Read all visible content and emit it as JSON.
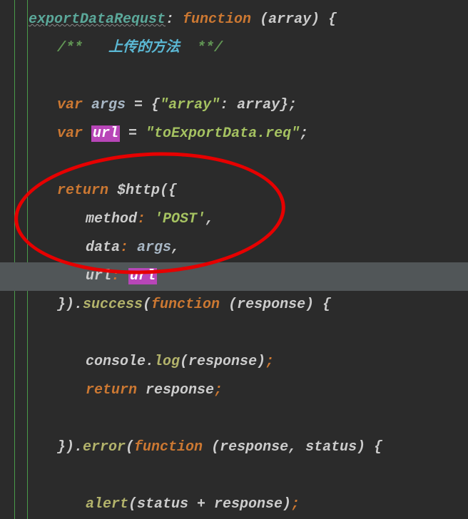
{
  "code": {
    "line1": {
      "fnName": "exportDataRequst",
      "colon": ": ",
      "kwFunction": "function",
      "params": " (array) {"
    },
    "line2": {
      "commentStart": "/**   ",
      "commentCn": "上传的方法",
      "commentEnd": "  **/"
    },
    "line4": {
      "kwVar": "var ",
      "ident": "args",
      "eq": " = ",
      "brace1": "{",
      "str": "\"array\"",
      "colon": ": ",
      "val": "array",
      "brace2": "};"
    },
    "line5": {
      "kwVar": "var ",
      "identHl": "url",
      "eq": " = ",
      "str": "\"toExportData.req\"",
      "semi": ";"
    },
    "line7": {
      "kwReturn": "return ",
      "call": "$http({"
    },
    "line8": {
      "prop": "method",
      "colon": ": ",
      "str": "'POST'",
      "comma": ","
    },
    "line9": {
      "prop": "data",
      "colon": ": ",
      "val": "args",
      "comma": ","
    },
    "line10": {
      "prop": "url",
      "colon": ": ",
      "valHl": "url"
    },
    "line11": {
      "close": "}).",
      "method": "success",
      "open": "(",
      "kwFunction": "function",
      "params": " (response) {"
    },
    "line13": {
      "obj": "console",
      "dot": ".",
      "method": "log",
      "args": "(response)",
      "semi": ";"
    },
    "line14": {
      "kwReturn": "return ",
      "val": "response",
      "semi": ";"
    },
    "line16": {
      "close": "}).",
      "method": "error",
      "open": "(",
      "kwFunction": "function",
      "params": " (response, status) {"
    },
    "line18": {
      "fn": "alert",
      "args": "(status + response)",
      "semi": ";"
    }
  }
}
